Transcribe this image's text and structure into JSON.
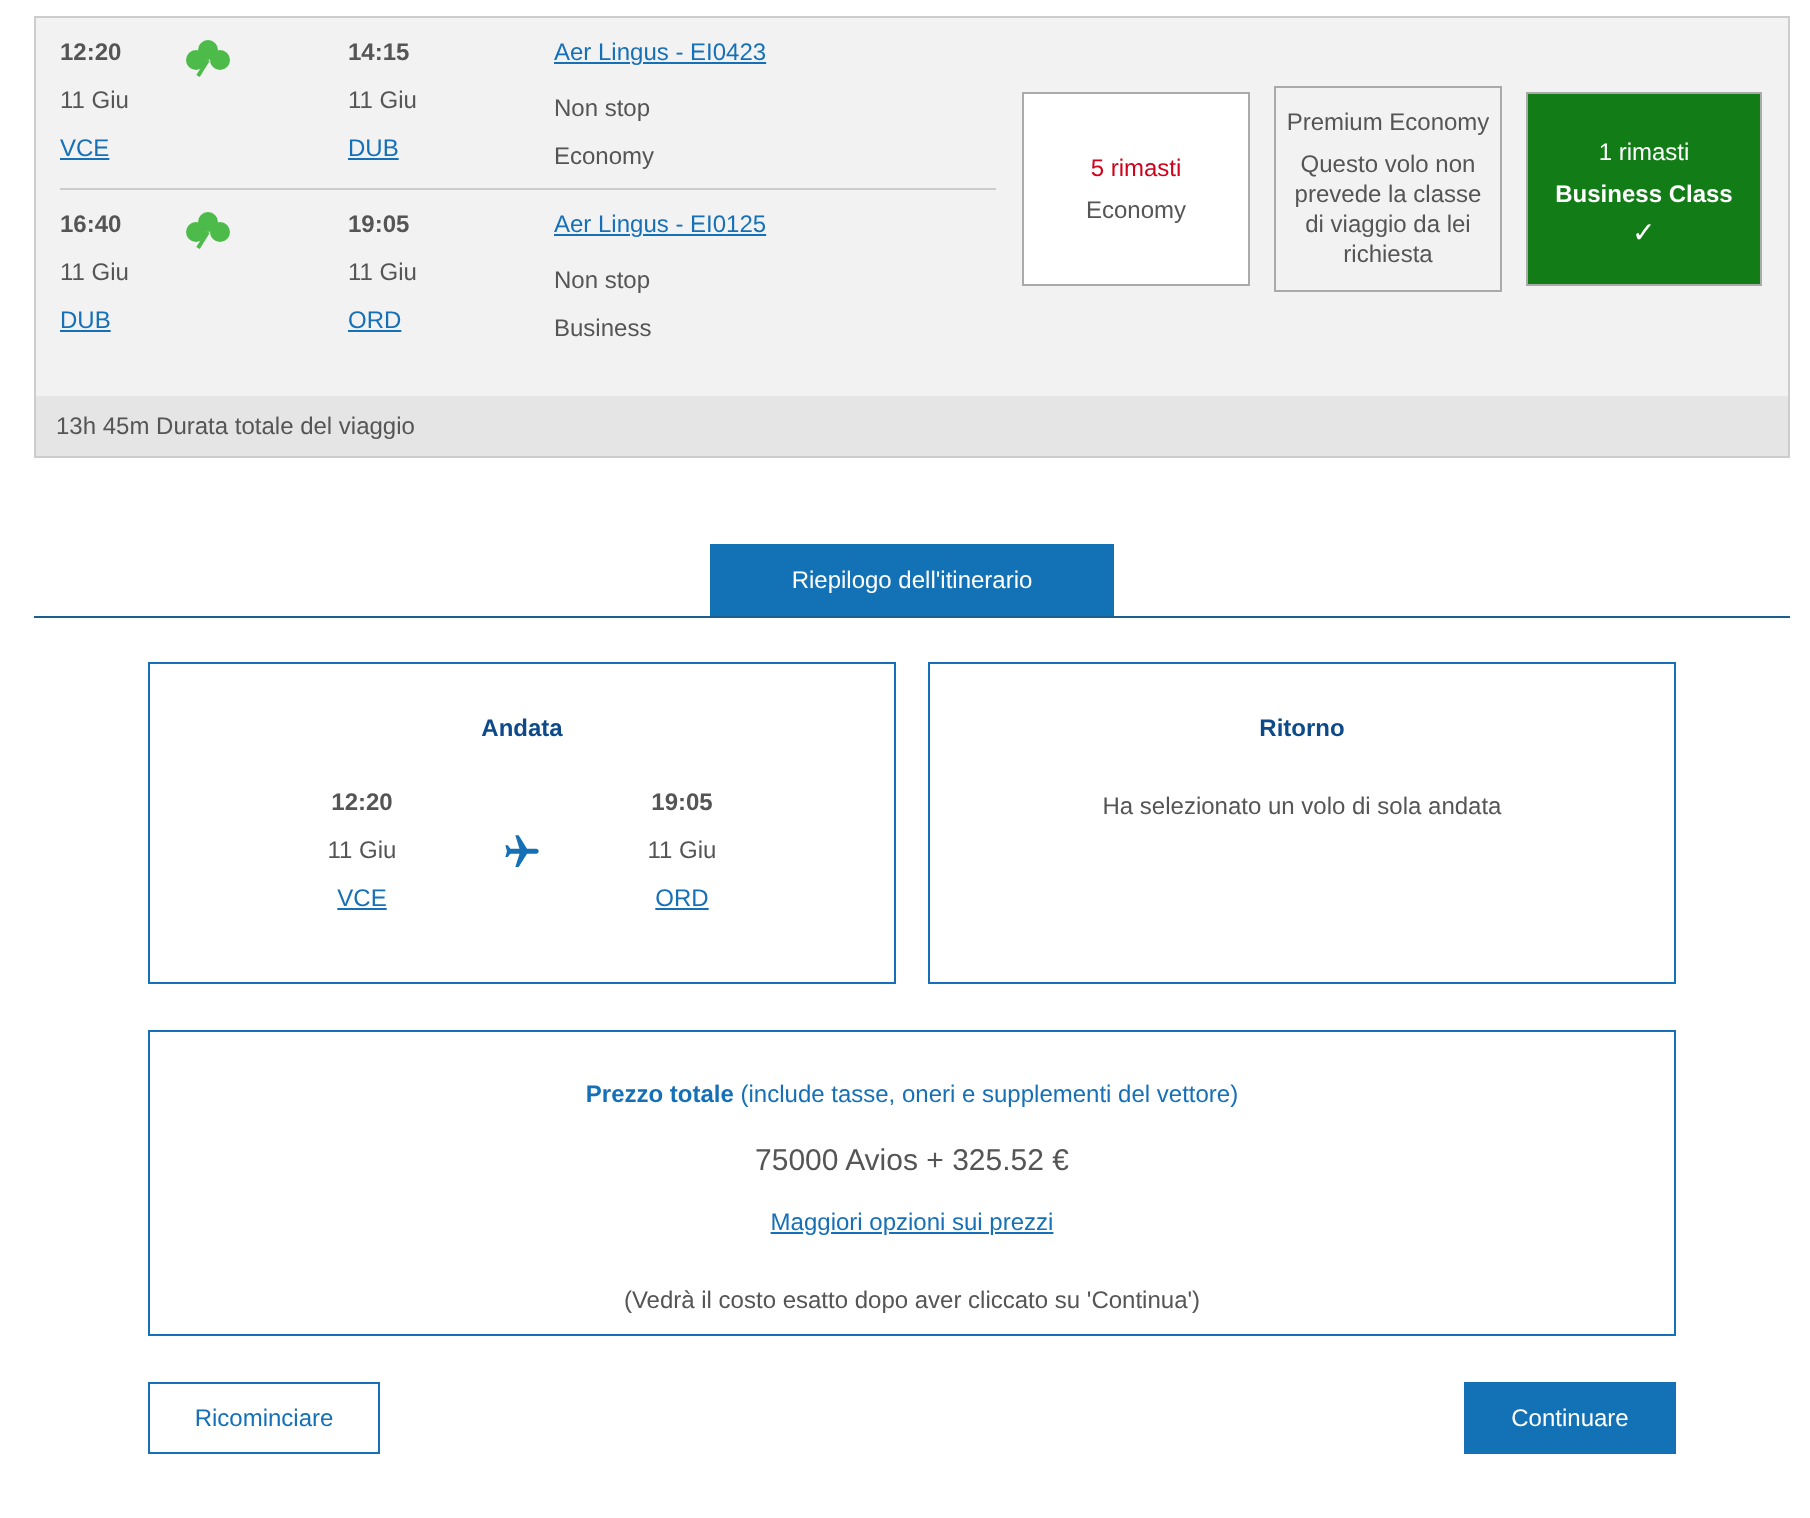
{
  "flight": {
    "legs": [
      {
        "depart_time": "12:20",
        "depart_date": "11 Giu",
        "depart_airport": "VCE",
        "arrive_time": "14:15",
        "arrive_date": "11 Giu",
        "arrive_airport": "DUB",
        "flight": "Aer Lingus - EI0423",
        "stops": "Non stop",
        "cabin": "Economy"
      },
      {
        "depart_time": "16:40",
        "depart_date": "11 Giu",
        "depart_airport": "DUB",
        "arrive_time": "19:05",
        "arrive_date": "11 Giu",
        "arrive_airport": "ORD",
        "flight": "Aer Lingus - EI0125",
        "stops": "Non stop",
        "cabin": "Business"
      }
    ],
    "fares": [
      {
        "kind": "available",
        "selected": false,
        "lines": [
          "5 rimasti",
          "Economy"
        ]
      },
      {
        "kind": "unavailable",
        "selected": false,
        "lines": [
          "Premium Economy",
          "Questo volo non prevede la classe di viaggio da lei richiesta"
        ]
      },
      {
        "kind": "available",
        "selected": true,
        "lines": [
          "1 rimasti",
          "Business Class",
          "✓"
        ]
      }
    ],
    "duration": "13h 45m Durata totale del viaggio"
  },
  "summary_tab": {
    "label": "Riepilogo dell'itinerario",
    "selected": true
  },
  "outbound": {
    "title": "Andata",
    "depart_time": "12:20",
    "depart_date": "11 Giu",
    "depart_airport": "VCE",
    "arrive_time": "19:05",
    "arrive_date": "11 Giu",
    "arrive_airport": "ORD"
  },
  "return": {
    "title": "Ritorno",
    "message": "Ha selezionato un volo di sola andata"
  },
  "price": {
    "heading": "**Prezzo totale** (include tasse, oneri e supplementi del vettore)",
    "amount": "75000 Avios + 325.52 €",
    "link": "Maggiori opzioni sui prezzi",
    "note": "(Vedrà il costo esatto dopo aver cliccato su 'Continua')"
  },
  "buttons": {
    "restart": "Ricominciare",
    "continue": "Continuare"
  }
}
